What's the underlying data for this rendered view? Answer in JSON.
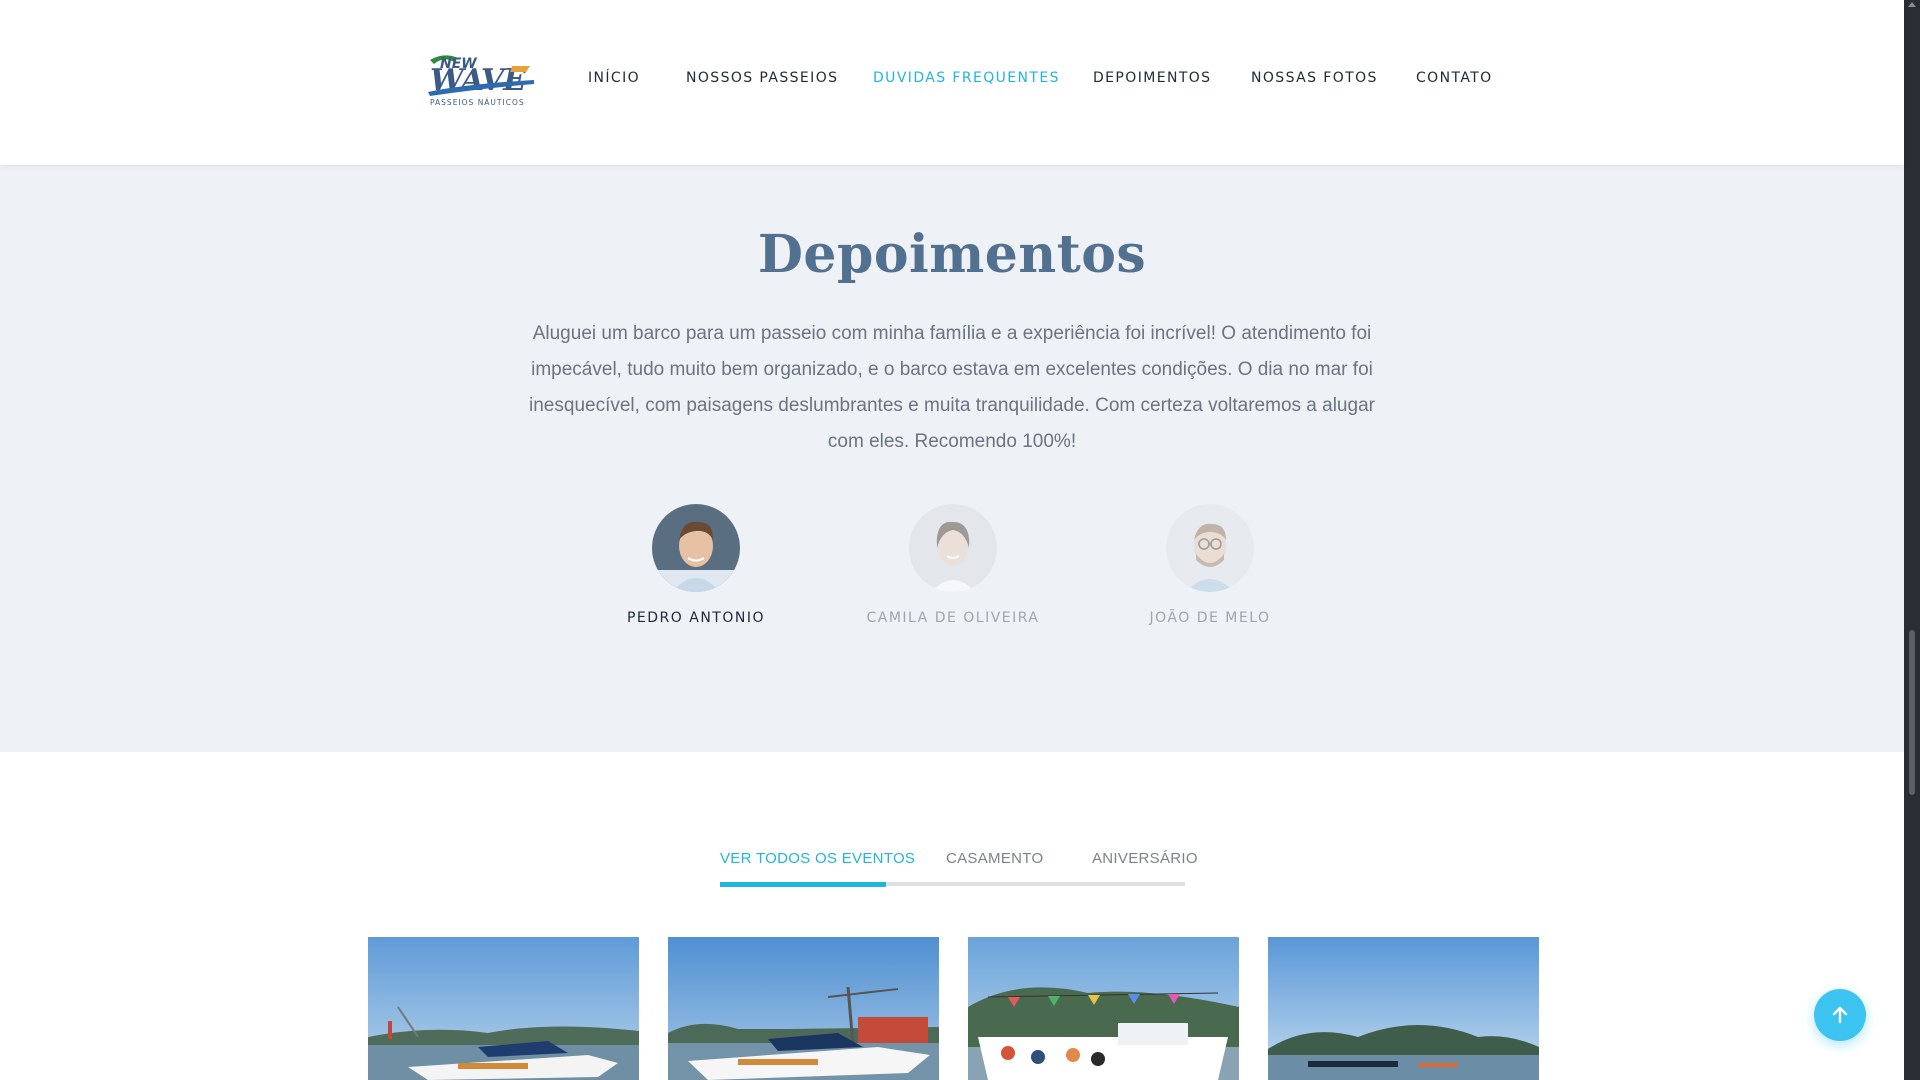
{
  "header": {
    "logo": {
      "name": "new-wave-logo",
      "line1": "NEW",
      "line2": "WAVE",
      "tagline": "PASSEIOS NÁUTICOS"
    },
    "nav": [
      {
        "label": "INÍCIO",
        "active": false
      },
      {
        "label": "NOSSOS PASSEIOS",
        "active": false
      },
      {
        "label": "DUVIDAS FREQUENTES",
        "active": true
      },
      {
        "label": "DEPOIMENTOS",
        "active": false
      },
      {
        "label": "NOSSAS FOTOS",
        "active": false
      },
      {
        "label": "CONTATO",
        "active": false
      }
    ]
  },
  "testimonials": {
    "title": "Depoimentos",
    "quote": "Aluguei um barco para um passeio com minha família e a experiência foi incrível! O atendimento foi impecável, tudo muito bem organizado, e o barco estava em excelentes condições. O dia no mar foi inesquecível, com paisagens deslumbrantes e muita tranquilidade. Com certeza voltaremos a alugar com eles. Recomendo 100%!",
    "people": [
      {
        "name": "PEDRO ANTONIO",
        "active": true
      },
      {
        "name": "CAMILA DE OLIVEIRA",
        "active": false
      },
      {
        "name": "JOÃO DE MELO",
        "active": false
      }
    ]
  },
  "events": {
    "tabs": [
      {
        "label": "VER TODOS OS EVENTOS",
        "active": true
      },
      {
        "label": "CASAMENTO",
        "active": false
      },
      {
        "label": "ANIVERSÁRIO",
        "active": false
      }
    ],
    "gallery": [
      {
        "name": "speedboat-harbor-photo"
      },
      {
        "name": "speedboat-crane-photo"
      },
      {
        "name": "party-yacht-photo"
      },
      {
        "name": "bay-island-photo"
      }
    ]
  },
  "colors": {
    "accent": "#1fb6d9",
    "title": "#52708f",
    "section_bg": "#eef1f6",
    "back_to_top": "#3cc3f0"
  },
  "icons": {
    "back_to_top": "arrow-up-icon"
  }
}
